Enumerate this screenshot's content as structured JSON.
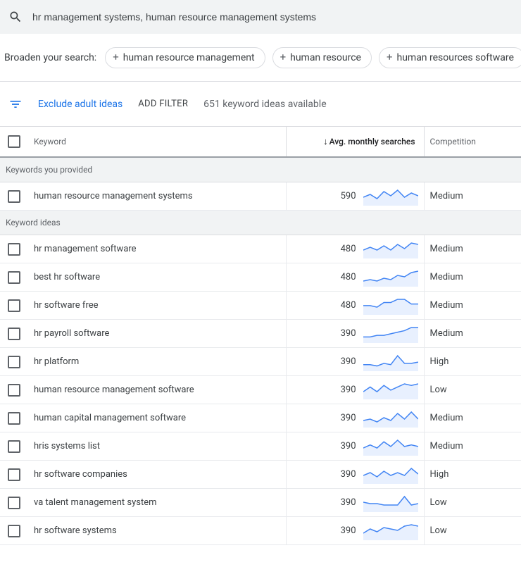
{
  "search": {
    "query": "hr management systems, human resource management systems"
  },
  "broaden": {
    "label": "Broaden your search:",
    "chips": [
      "human resource management",
      "human resource",
      "human resources software"
    ]
  },
  "filters": {
    "exclude_label": "Exclude adult ideas",
    "add_filter_label": "ADD FILTER",
    "ideas_count": "651 keyword ideas available"
  },
  "columns": {
    "keyword": "Keyword",
    "searches": "Avg. monthly searches",
    "competition": "Competition"
  },
  "sections": {
    "provided": "Keywords you provided",
    "ideas": "Keyword ideas"
  },
  "rows": {
    "provided": [
      {
        "keyword": "human resource management systems",
        "searches": "590",
        "competition": "Medium",
        "spark": [
          10,
          14,
          8,
          18,
          12,
          20,
          10,
          16,
          12
        ]
      }
    ],
    "ideas": [
      {
        "keyword": "hr management software",
        "searches": "480",
        "competition": "Medium",
        "spark": [
          10,
          14,
          10,
          16,
          10,
          18,
          12,
          20,
          18
        ]
      },
      {
        "keyword": "best hr software",
        "searches": "480",
        "competition": "Medium",
        "spark": [
          6,
          8,
          6,
          10,
          8,
          14,
          12,
          18,
          20
        ]
      },
      {
        "keyword": "hr software free",
        "searches": "480",
        "competition": "Medium",
        "spark": [
          10,
          10,
          8,
          14,
          14,
          18,
          18,
          12,
          12
        ]
      },
      {
        "keyword": "hr payroll software",
        "searches": "390",
        "competition": "Medium",
        "spark": [
          6,
          6,
          8,
          8,
          10,
          12,
          14,
          18,
          18
        ]
      },
      {
        "keyword": "hr platform",
        "searches": "390",
        "competition": "High",
        "spark": [
          8,
          8,
          6,
          10,
          8,
          22,
          10,
          10,
          12
        ]
      },
      {
        "keyword": "human resource management software",
        "searches": "390",
        "competition": "Low",
        "spark": [
          8,
          14,
          8,
          16,
          10,
          14,
          18,
          16,
          18
        ]
      },
      {
        "keyword": "human capital management software",
        "searches": "390",
        "competition": "Medium",
        "spark": [
          8,
          10,
          6,
          12,
          8,
          18,
          10,
          20,
          10
        ]
      },
      {
        "keyword": "hris systems list",
        "searches": "390",
        "competition": "Medium",
        "spark": [
          8,
          12,
          8,
          16,
          10,
          18,
          10,
          12,
          10
        ]
      },
      {
        "keyword": "hr software companies",
        "searches": "390",
        "competition": "High",
        "spark": [
          10,
          14,
          8,
          16,
          10,
          14,
          10,
          20,
          12
        ]
      },
      {
        "keyword": "va talent management system",
        "searches": "390",
        "competition": "Low",
        "spark": [
          12,
          10,
          10,
          8,
          8,
          8,
          20,
          8,
          10
        ]
      },
      {
        "keyword": "hr software systems",
        "searches": "390",
        "competition": "Low",
        "spark": [
          8,
          14,
          10,
          16,
          14,
          12,
          18,
          20,
          18
        ]
      }
    ]
  }
}
